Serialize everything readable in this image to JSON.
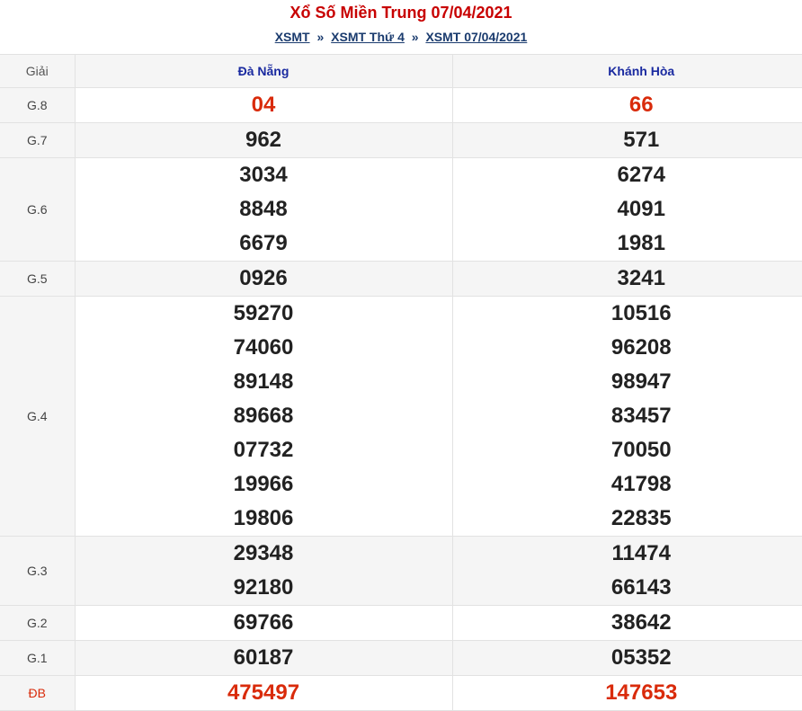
{
  "title": "Xổ Số Miền Trung 07/04/2021",
  "breadcrumb": {
    "items": [
      "XSMT",
      "XSMT Thứ 4",
      "XSMT 07/04/2021"
    ],
    "separator": "»"
  },
  "table": {
    "prize_header": "Giải",
    "provinces": [
      "Đà Nẵng",
      "Khánh Hòa"
    ],
    "rows": [
      {
        "prize": "G.8",
        "values": [
          [
            "04"
          ],
          [
            "66"
          ]
        ]
      },
      {
        "prize": "G.7",
        "values": [
          [
            "962"
          ],
          [
            "571"
          ]
        ]
      },
      {
        "prize": "G.6",
        "values": [
          [
            "3034",
            "8848",
            "6679"
          ],
          [
            "6274",
            "4091",
            "1981"
          ]
        ]
      },
      {
        "prize": "G.5",
        "values": [
          [
            "0926"
          ],
          [
            "3241"
          ]
        ]
      },
      {
        "prize": "G.4",
        "values": [
          [
            "59270",
            "74060",
            "89148",
            "89668",
            "07732",
            "19966",
            "19806"
          ],
          [
            "10516",
            "96208",
            "98947",
            "83457",
            "70050",
            "41798",
            "22835"
          ]
        ]
      },
      {
        "prize": "G.3",
        "values": [
          [
            "29348",
            "92180"
          ],
          [
            "11474",
            "66143"
          ]
        ]
      },
      {
        "prize": "G.2",
        "values": [
          [
            "69766"
          ],
          [
            "38642"
          ]
        ]
      },
      {
        "prize": "G.1",
        "values": [
          [
            "60187"
          ],
          [
            "05352"
          ]
        ]
      },
      {
        "prize": "ĐB",
        "values": [
          [
            "475497"
          ],
          [
            "147653"
          ]
        ]
      }
    ]
  },
  "colors": {
    "title": "#c80000",
    "link": "#1a3b6e",
    "province_header": "#1a2aa0",
    "highlight_number": "#d92b0b",
    "number": "#222222",
    "alt_row_bg": "#f5f5f5"
  }
}
